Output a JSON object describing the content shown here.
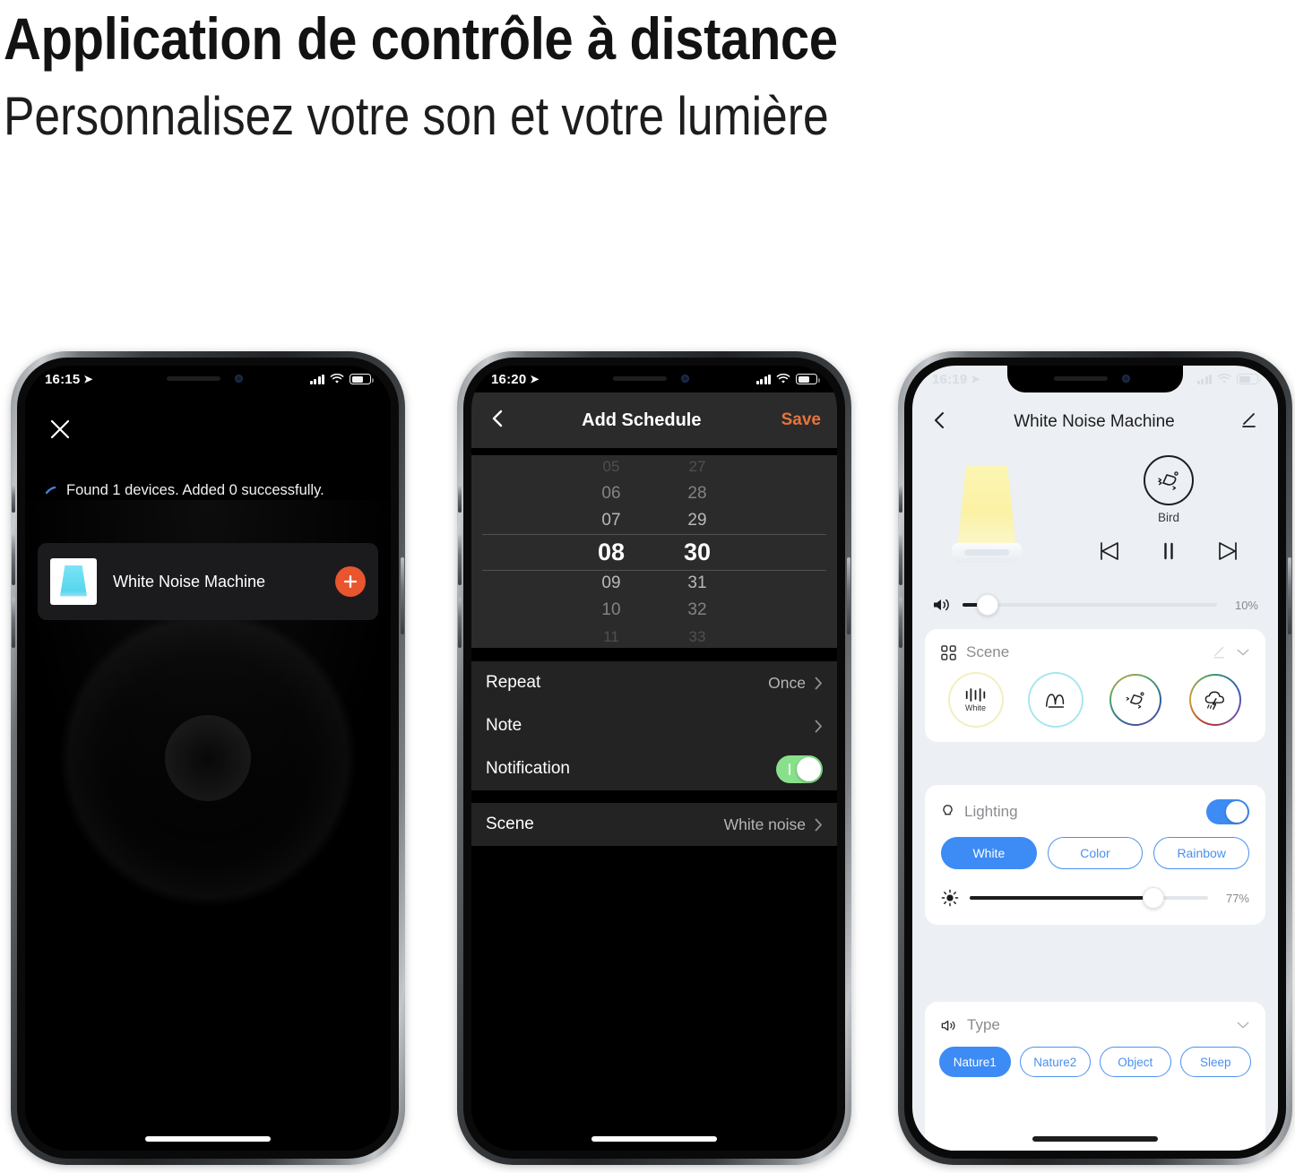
{
  "headline": {
    "title": "Application de contrôle à distance",
    "subtitle": "Personnalisez votre son et votre lumière"
  },
  "colors": {
    "accent_orange": "#e8552e",
    "accent_blue": "#3d8bf5",
    "toggle_green": "#89e08c",
    "save_orange": "#e8733c",
    "phone3_bg": "#eceff3"
  },
  "phone1": {
    "status": {
      "time": "16:15",
      "location_icon": "location-arrow",
      "signal": "signal-bars",
      "wifi": "wifi-icon",
      "battery": "battery-icon"
    },
    "close_label": "close-icon",
    "scan_message": "Found 1 devices. Added 0 successfully.",
    "device": {
      "name": "White Noise Machine",
      "thumb": "lamp-thumbnail",
      "add_label": "plus-icon"
    }
  },
  "phone2": {
    "status": {
      "time": "16:20"
    },
    "nav": {
      "back": "back-chevron",
      "title": "Add Schedule",
      "save": "Save"
    },
    "picker": {
      "hours": [
        "05",
        "06",
        "07",
        "08",
        "09",
        "10",
        "11"
      ],
      "minutes": [
        "27",
        "28",
        "29",
        "30",
        "31",
        "32",
        "33"
      ],
      "selected_hour": "08",
      "selected_minute": "30"
    },
    "rows": [
      {
        "label": "Repeat",
        "value": "Once",
        "type": "chevron"
      },
      {
        "label": "Note",
        "value": "",
        "type": "chevron"
      },
      {
        "label": "Notification",
        "value": "",
        "type": "toggle",
        "on": true
      }
    ],
    "scene_row": {
      "label": "Scene",
      "value": "White noise",
      "type": "chevron"
    }
  },
  "phone3": {
    "status": {
      "time": "16:19"
    },
    "nav": {
      "back": "back-chevron",
      "title": "White Noise Machine",
      "edit": "pencil-icon"
    },
    "hero": {
      "lamp": "lamp-image",
      "sound_name": "Bird",
      "sound_icon": "bird-icon",
      "prev": "previous-track-icon",
      "play_pause": "pause-icon",
      "next": "next-track-icon"
    },
    "volume": {
      "icon": "volume-icon",
      "value": "10%",
      "percent": 10
    },
    "scene": {
      "icon": "grid-icon",
      "title": "Scene",
      "edit_icon": "pencil-icon",
      "collapse_icon": "chevron-down-icon",
      "items": [
        {
          "name": "White",
          "icon": "sound-bars-icon",
          "ring": "pale-yellow",
          "label": "White"
        },
        {
          "name": "Wave",
          "icon": "wave-icon",
          "ring": "cyan",
          "label": ""
        },
        {
          "name": "Bird",
          "icon": "bird-icon",
          "ring": "gradient",
          "label": ""
        },
        {
          "name": "Storm",
          "icon": "storm-cloud-icon",
          "ring": "rainbow",
          "label": ""
        }
      ]
    },
    "lighting": {
      "icon": "bulb-icon",
      "title": "Lighting",
      "toggle_on": true,
      "modes": [
        {
          "label": "White",
          "selected": true
        },
        {
          "label": "Color",
          "selected": false
        },
        {
          "label": "Rainbow",
          "selected": false
        }
      ],
      "brightness": {
        "icon": "brightness-icon",
        "value": "77%",
        "percent": 77
      }
    },
    "type": {
      "icon": "speaker-icon",
      "title": "Type",
      "collapse_icon": "chevron-down-icon",
      "options": [
        {
          "label": "Nature1",
          "selected": true
        },
        {
          "label": "Nature2",
          "selected": false
        },
        {
          "label": "Object",
          "selected": false
        },
        {
          "label": "Sleep",
          "selected": false
        }
      ]
    }
  }
}
